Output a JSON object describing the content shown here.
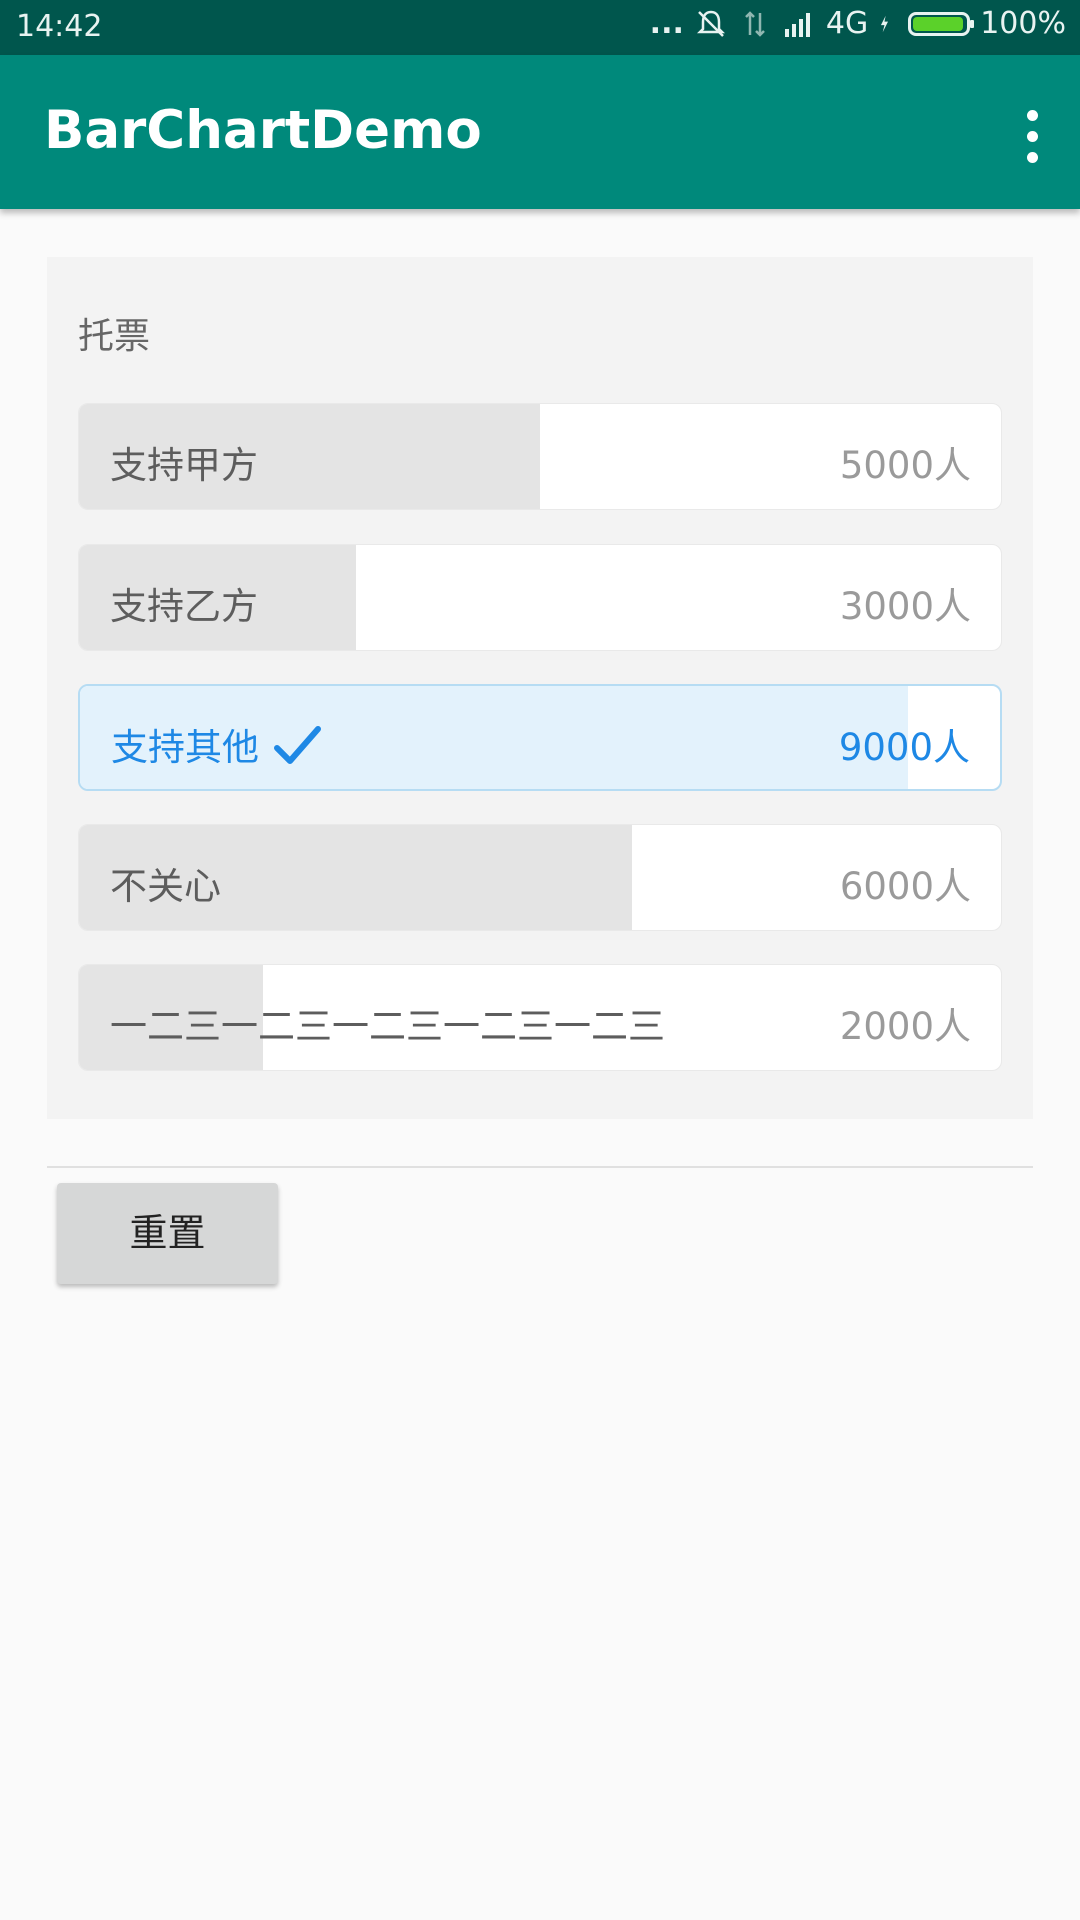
{
  "status_bar": {
    "time": "14:42",
    "more_dots": "...",
    "network": "4G",
    "battery_percent": "100%",
    "icons": [
      "more-dots-icon",
      "bell-muted-icon",
      "data-arrows-icon",
      "signal-icon",
      "charging-icon",
      "battery-icon"
    ]
  },
  "app_bar": {
    "title": "BarChartDemo",
    "overflow_icon": "more-vertical-icon"
  },
  "vote": {
    "heading": "托票",
    "options": [
      {
        "label": "支持甲方",
        "count": "5000人",
        "fraction": 0.5,
        "selected": false
      },
      {
        "label": "支持乙方",
        "count": "3000人",
        "fraction": 0.3,
        "selected": false
      },
      {
        "label": "支持其他",
        "count": "9000人",
        "fraction": 0.9,
        "selected": true
      },
      {
        "label": "不关心",
        "count": "6000人",
        "fraction": 0.6,
        "selected": false
      },
      {
        "label": "一二三一二三一二三一二三一二三",
        "count": "2000人",
        "fraction": 0.2,
        "selected": false
      }
    ],
    "accent_color": "#1e88e5"
  },
  "actions": {
    "reset_label": "重置"
  },
  "colors": {
    "status_bar": "#00564d",
    "app_bar": "#00897b",
    "bar_fill": "#e4e4e4",
    "selected_fill": "#e3f2fc"
  }
}
